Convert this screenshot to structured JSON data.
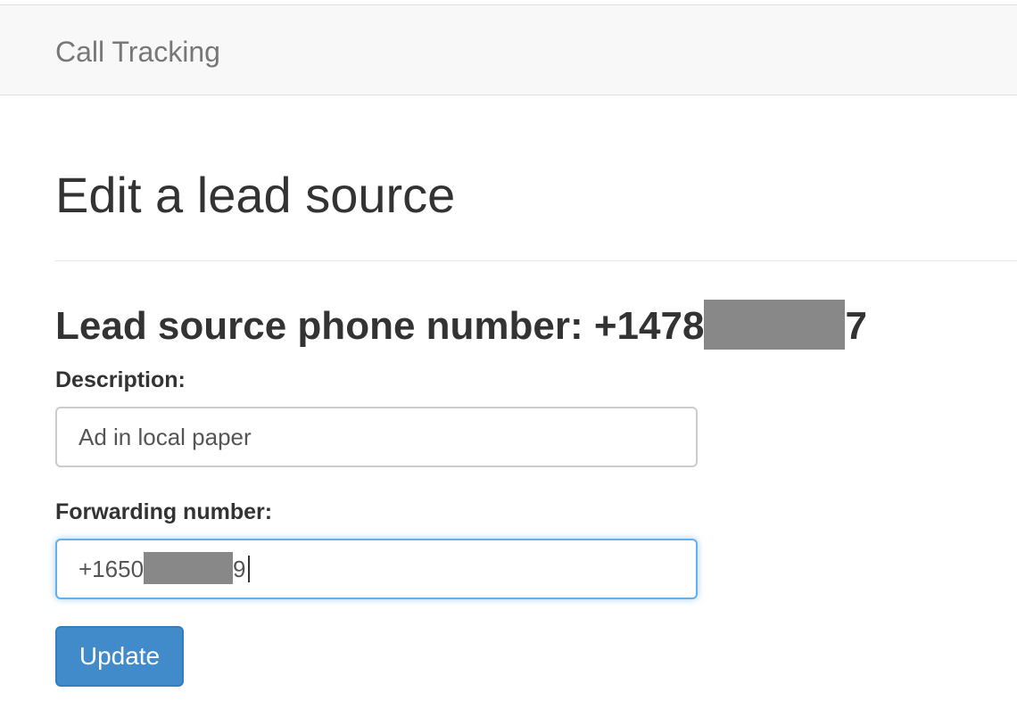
{
  "navbar": {
    "brand": "Call Tracking"
  },
  "page": {
    "title": "Edit a lead source"
  },
  "lead_source": {
    "phone_label_prefix": "Lead source phone number: +1478",
    "phone_label_suffix": "7"
  },
  "form": {
    "description_label": "Description:",
    "description_value": "Ad in local paper",
    "forwarding_label": "Forwarding number:",
    "forwarding_value_prefix": "+1650",
    "forwarding_value_suffix": "9",
    "submit_label": "Update"
  },
  "colors": {
    "primary_button": "#428bca",
    "focus_border": "#66afe9",
    "redaction": "#888888"
  }
}
